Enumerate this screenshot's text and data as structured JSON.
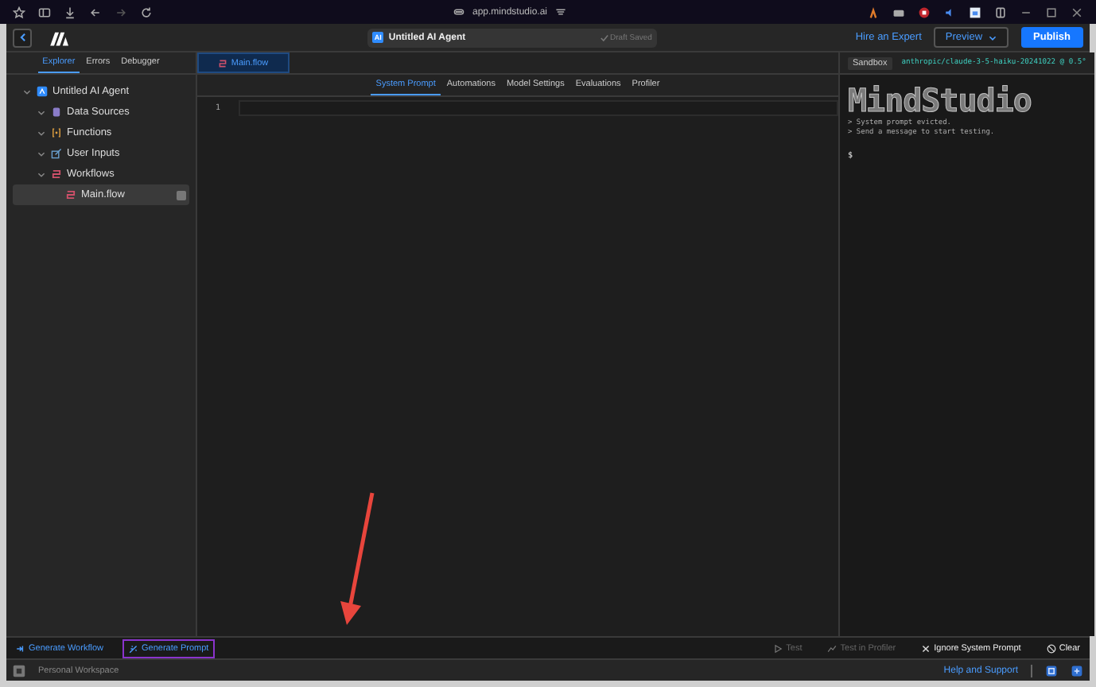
{
  "browser": {
    "url": "app.mindstudio.ai"
  },
  "header": {
    "agent_badge": "AI",
    "agent_title": "Untitled AI Agent",
    "draft_status": "Draft Saved",
    "hire_link": "Hire an Expert",
    "preview_button": "Preview",
    "publish_button": "Publish"
  },
  "sidebar": {
    "tabs": [
      {
        "label": "Explorer",
        "selected": true
      },
      {
        "label": "Errors",
        "selected": false
      },
      {
        "label": "Debugger",
        "selected": false
      }
    ],
    "tree": [
      {
        "label": "Untitled AI Agent",
        "kind": "agent",
        "expanded": true,
        "selected": false,
        "children": [
          {
            "label": "Data Sources",
            "kind": "data",
            "expanded": true,
            "selected": false
          },
          {
            "label": "Functions",
            "kind": "function",
            "expanded": true,
            "selected": false
          },
          {
            "label": "User Inputs",
            "kind": "input",
            "expanded": true,
            "selected": false
          },
          {
            "label": "Workflows",
            "kind": "workflow",
            "expanded": true,
            "selected": false,
            "children": [
              {
                "label": "Main.flow",
                "kind": "flow",
                "selected": true
              }
            ]
          }
        ]
      }
    ]
  },
  "editor": {
    "file_tabs": [
      {
        "label": "Main.flow",
        "selected": true
      }
    ],
    "tabs": [
      {
        "label": "System Prompt",
        "selected": true
      },
      {
        "label": "Automations",
        "selected": false
      },
      {
        "label": "Model Settings",
        "selected": false
      },
      {
        "label": "Evaluations",
        "selected": false
      },
      {
        "label": "Profiler",
        "selected": false
      }
    ],
    "line_numbers": [
      "1"
    ]
  },
  "sandbox": {
    "label": "Sandbox",
    "model": "anthropic/claude-3-5-haiku-20241022 @ 0.5°",
    "logo": "MindStudio",
    "lines": [
      "> System prompt evicted.",
      "> Send a message to start testing."
    ],
    "prompt": "$"
  },
  "bottom_toolbar": {
    "left": [
      {
        "label": "Generate Workflow",
        "kind": "workflow",
        "highlighted": false
      },
      {
        "label": "Generate Prompt",
        "kind": "prompt",
        "highlighted": true
      }
    ],
    "right": [
      {
        "label": "Test",
        "kind": "test",
        "disabled": true
      },
      {
        "label": "Test in Profiler",
        "kind": "profiler",
        "disabled": true
      },
      {
        "label": "Ignore System Prompt",
        "kind": "ignore",
        "disabled": false
      },
      {
        "label": "Clear",
        "kind": "clear",
        "disabled": false
      }
    ]
  },
  "footer": {
    "workspace": "Personal Workspace",
    "help_link": "Help and Support"
  }
}
